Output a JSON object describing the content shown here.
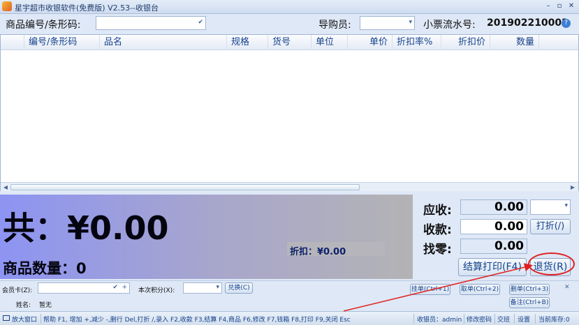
{
  "window": {
    "title": "星宇超市收银软件(免费版) V2.53--收银台",
    "minimize_glyph": "–",
    "restore_glyph": "▫",
    "close_glyph": "✕"
  },
  "top": {
    "product_code_label": "商品编号/条形码:",
    "product_code_value": "",
    "salesperson_label": "导购员:",
    "salesperson_value": "",
    "receipt_label": "小票流水号:",
    "receipt_value": "201902210002"
  },
  "grid": {
    "columns": [
      "编号/条形码",
      "品名",
      "规格",
      "货号",
      "单位",
      "单价",
      "折扣率%",
      "折扣价",
      "数量"
    ],
    "rows": []
  },
  "totals": {
    "total_text": "共：¥0.00",
    "quantity_text": "商品数量：0",
    "discount_text": "折扣：¥0.00"
  },
  "settle": {
    "due_label": "应收:",
    "due_value": "0.00",
    "received_label": "收款:",
    "received_value": "0.00",
    "change_label": "找零:",
    "change_value": "0.00",
    "discount_button": "打折(/)",
    "checkout_button": "结算打印(F4)",
    "return_button": "退货(R)"
  },
  "member": {
    "card_label": "会员卡(Z):",
    "card_value": "",
    "points_label": "本次积分(X):",
    "points_value": "",
    "redeem_button": "兑换(C)",
    "name_label": "姓名:",
    "name_value": "暂无",
    "hang_button": "挂单(Ctrl+1)",
    "take_button": "取单(Ctrl+2)",
    "delete_button": "删单(Ctrl+3)",
    "remark_button": "备注(Ctrl+B)",
    "close_glyph": "✕"
  },
  "status": {
    "enlarge_button": "放大窗口",
    "help_text": "帮助 F1, 增加 +,减少 -,删行 Del,打折 /,录入 F2,收款 F3,结算 F4,商品 F6,修改 F7,钱箱 F8,打印 F9,关闭 Esc",
    "cashier_text": "收银员：admin",
    "change_password": "修改密码",
    "handover": "交班",
    "settings": "设置",
    "stock_text": "当前库存:0"
  },
  "colors": {
    "accent": "#15428b",
    "highlight_circle": "#e02020",
    "total_gradient_start": "#8d94f2"
  }
}
